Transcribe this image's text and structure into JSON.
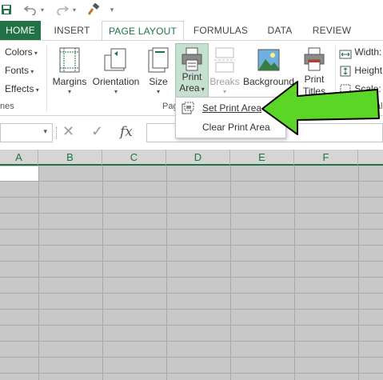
{
  "qat": {
    "save": "save-icon",
    "undo": "undo-icon",
    "redo": "redo-icon",
    "format_painter": "brush-icon",
    "customize": "▾"
  },
  "tabs": [
    "HOME",
    "INSERT",
    "PAGE LAYOUT",
    "FORMULAS",
    "DATA",
    "REVIEW"
  ],
  "themes_group": {
    "colors": "Colors",
    "fonts": "Fonts",
    "effects": "Effects",
    "label": "nes"
  },
  "page_setup_group": {
    "margins": "Margins",
    "orientation": "Orientation",
    "size": "Size",
    "print_area_line1": "Print",
    "print_area_line2": "Area",
    "breaks": "Breaks",
    "background": "Background",
    "print_titles_line1": "Print",
    "print_titles_line2": "Titles",
    "label": "Pag"
  },
  "scale_group": {
    "width": "Width:",
    "height": "Height",
    "scale": "Scale:",
    "label": "Scal"
  },
  "print_area_menu": {
    "set": "Set Print Area",
    "clear": "Clear Print Area"
  },
  "formula_bar": {
    "cancel": "✕",
    "enter": "✓",
    "fx": "fx"
  },
  "columns": [
    "A",
    "B",
    "C",
    "D",
    "E",
    "F"
  ],
  "colors": {
    "accent": "#217346",
    "arrow": "#5bd626",
    "arrow_outline": "#000000"
  }
}
